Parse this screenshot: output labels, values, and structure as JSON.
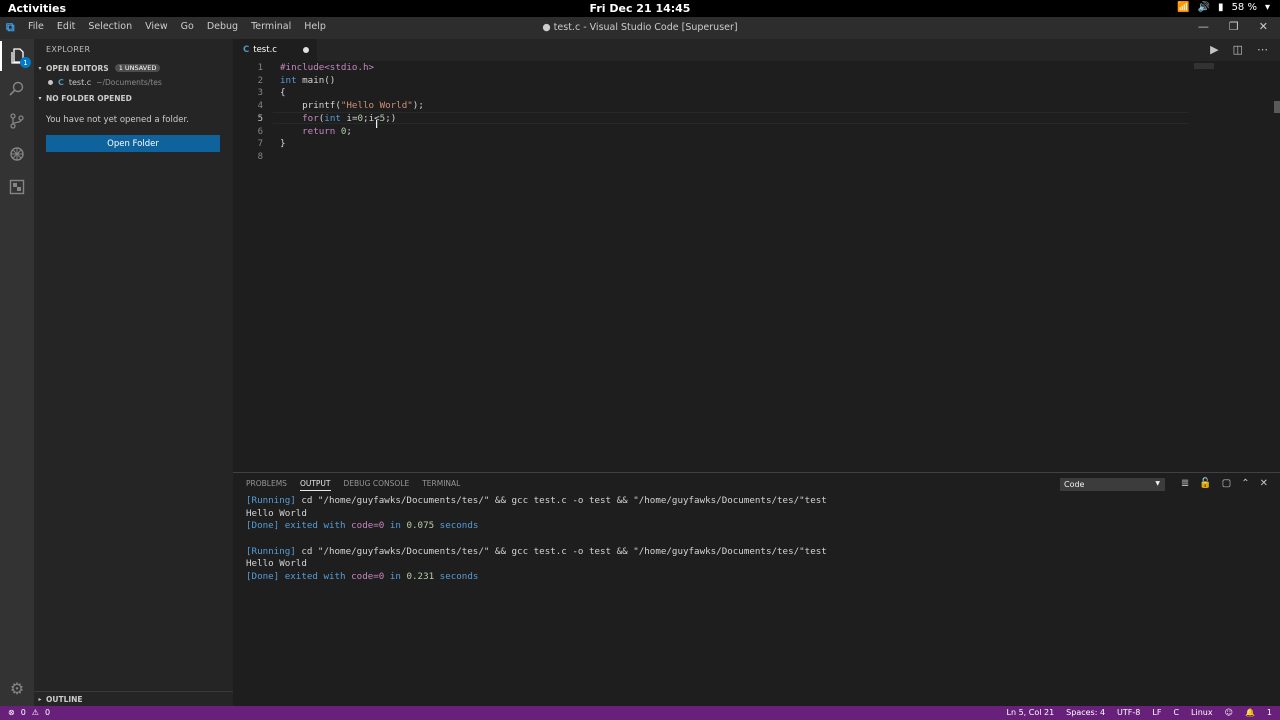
{
  "topbar": {
    "activities": "Activities",
    "clock": "Fri Dec 21  14:45",
    "battery": "58 %"
  },
  "window": {
    "title": "● test.c - Visual Studio Code [Superuser]",
    "menu": [
      "File",
      "Edit",
      "Selection",
      "View",
      "Go",
      "Debug",
      "Terminal",
      "Help"
    ]
  },
  "activitybar": {
    "explorer_badge": "1"
  },
  "sidebar": {
    "header": "EXPLORER",
    "open_editors": "OPEN EDITORS",
    "unsaved_badge": "1 UNSAVED",
    "open_file_name": "test.c",
    "open_file_path": "~/Documents/tes",
    "no_folder": "NO FOLDER OPENED",
    "message": "You have not yet opened a folder.",
    "open_folder_button": "Open Folder",
    "outline": "OUTLINE"
  },
  "editor": {
    "tab_label": "test.c",
    "active_line": 5,
    "lines": [
      {
        "n": "1",
        "tokens": [
          {
            "t": "#include<stdio.h>",
            "c": "pp"
          }
        ]
      },
      {
        "n": "2",
        "tokens": [
          {
            "t": "int",
            "c": "kw"
          },
          {
            "t": " main()",
            "c": "pl"
          }
        ]
      },
      {
        "n": "3",
        "tokens": [
          {
            "t": "{",
            "c": "pl"
          }
        ]
      },
      {
        "n": "4",
        "tokens": [
          {
            "t": "    printf(",
            "c": "pl"
          },
          {
            "t": "\"Hello World\"",
            "c": "str"
          },
          {
            "t": ");",
            "c": "pl"
          }
        ]
      },
      {
        "n": "5",
        "tokens": [
          {
            "t": "    for",
            "c": "pp"
          },
          {
            "t": "(",
            "c": "pl"
          },
          {
            "t": "int",
            "c": "kw"
          },
          {
            "t": " i=",
            "c": "pl"
          },
          {
            "t": "0",
            "c": "num"
          },
          {
            "t": ";i<",
            "c": "pl"
          },
          {
            "t": "5",
            "c": "num"
          },
          {
            "t": ";)",
            "c": "pl"
          }
        ]
      },
      {
        "n": "6",
        "tokens": [
          {
            "t": "    return",
            "c": "pp"
          },
          {
            "t": " ",
            "c": "pl"
          },
          {
            "t": "0",
            "c": "num"
          },
          {
            "t": ";",
            "c": "pl"
          }
        ]
      },
      {
        "n": "7",
        "tokens": [
          {
            "t": "}",
            "c": "pl"
          }
        ]
      },
      {
        "n": "8",
        "tokens": []
      }
    ]
  },
  "panel": {
    "tabs": [
      "PROBLEMS",
      "OUTPUT",
      "DEBUG CONSOLE",
      "TERMINAL"
    ],
    "active_tab": "OUTPUT",
    "channel": "Code",
    "output": [
      {
        "type": "run",
        "label": "[Running]",
        "cmd": " cd \"/home/guyfawks/Documents/tes/\" && gcc test.c -o test && \"/home/guyfawks/Documents/tes/\"test"
      },
      {
        "type": "text",
        "text": "Hello World"
      },
      {
        "type": "done",
        "label": "[Done]",
        "pre": " exited with ",
        "code": "code=0",
        "mid": " in ",
        "time": "0.075",
        "post": " seconds"
      },
      {
        "type": "blank"
      },
      {
        "type": "run",
        "label": "[Running]",
        "cmd": " cd \"/home/guyfawks/Documents/tes/\" && gcc test.c -o test && \"/home/guyfawks/Documents/tes/\"test"
      },
      {
        "type": "text",
        "text": "Hello World"
      },
      {
        "type": "done",
        "label": "[Done]",
        "pre": " exited with ",
        "code": "code=0",
        "mid": " in ",
        "time": "0.231",
        "post": " seconds"
      }
    ]
  },
  "statusbar": {
    "errors": "0",
    "warnings": "0",
    "position": "Ln 5, Col 21",
    "spaces": "Spaces: 4",
    "encoding": "UTF-8",
    "eol": "LF",
    "language": "C",
    "platform": "Linux",
    "notifications": "1"
  }
}
